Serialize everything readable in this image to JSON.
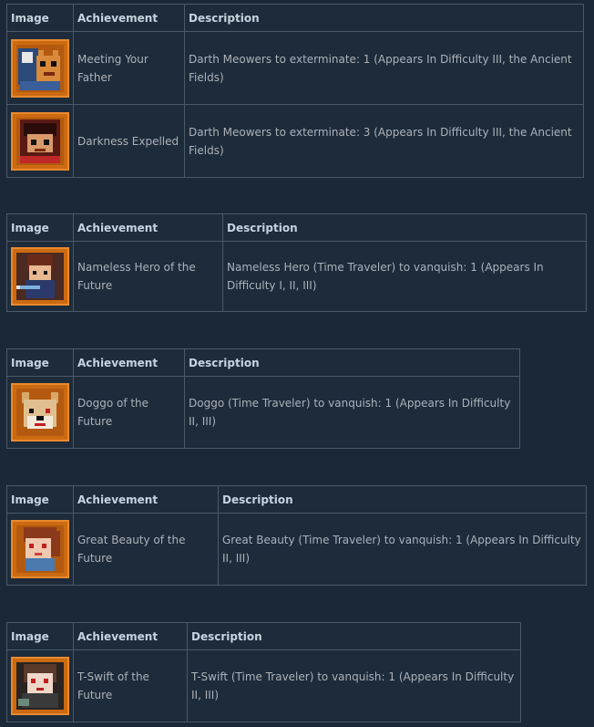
{
  "headers": {
    "image": "Image",
    "achievement": "Achievement",
    "description": "Description"
  },
  "tables": [
    {
      "rows": [
        {
          "icon": "kitten-helmet-icon",
          "name": "Meeting Your Father",
          "description": "Darth Meowers to exterminate: 1 (Appears In Difficulty III, the Ancient Fields)"
        },
        {
          "icon": "dark-hooded-hero-icon",
          "name": "Darkness Expelled",
          "description": "Darth Meowers to exterminate: 3 (Appears In Difficulty III, the Ancient Fields)"
        }
      ]
    },
    {
      "rows": [
        {
          "icon": "nameless-hero-icon",
          "name": "Nameless Hero of the Future",
          "description": "Nameless Hero (Time Traveler) to vanquish: 1 (Appears In Difficulty I, II, III)"
        }
      ]
    },
    {
      "rows": [
        {
          "icon": "doggo-icon",
          "name": "Doggo of the Future",
          "description": "Doggo (Time Traveler) to vanquish: 1 (Appears In Difficulty II, III)"
        }
      ]
    },
    {
      "rows": [
        {
          "icon": "great-beauty-icon",
          "name": "Great Beauty of the Future",
          "description": "Great Beauty (Time Traveler) to vanquish: 1 (Appears In Difficulty II, III)"
        }
      ]
    },
    {
      "rows": [
        {
          "icon": "t-swift-icon",
          "name": "T-Swift of the Future",
          "description": "T-Swift (Time Traveler) to vanquish: 1 (Appears In Difficulty II, III)"
        }
      ]
    }
  ],
  "colors": {
    "page_background": "#1b2838",
    "table_border": "#4b5a68",
    "header_text": "#c6d4df",
    "cell_text": "#acb2b8",
    "icon_frame": "#cc6a12"
  }
}
